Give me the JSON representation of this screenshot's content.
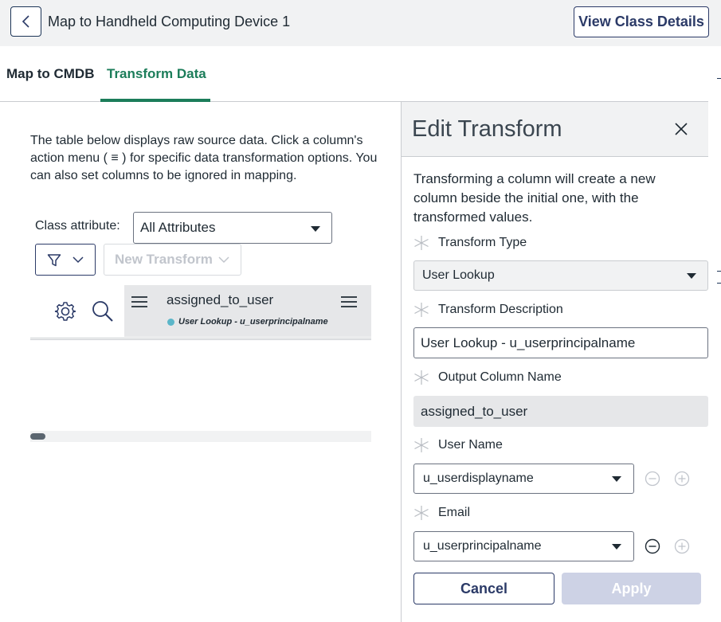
{
  "header": {
    "back_icon": "chevron-left-icon",
    "title": "Map to Handheld Computing Device 1",
    "view_class_details_label": "View Class Details"
  },
  "tabs": [
    {
      "label": "Map to CMDB",
      "active": false
    },
    {
      "label": "Transform Data",
      "active": true
    }
  ],
  "colors": {
    "accent_green": "#1c7d5a",
    "brand_navy": "#2b3a67",
    "status_dot": "#5bb6c9",
    "apply_disabled": "#cdd2e5"
  },
  "left": {
    "description": "The table below displays raw source data. Click a column's action menu ( ≡ ) for specific data transformation options. You can also set columns to be ignored in mapping.",
    "class_attribute_label": "Class attribute:",
    "class_attribute_value": "All Attributes",
    "new_transform_label": "New Transform",
    "column": {
      "name": "assigned_to_user",
      "subtitle": "User Lookup - u_userprincipalname"
    }
  },
  "panel": {
    "title": "Edit Transform",
    "description": "Transforming a column will create a new column beside the initial one, with the transformed values.",
    "transform_type_label": "Transform Type",
    "transform_type_value": "User Lookup",
    "transform_description_label": "Transform Description",
    "transform_description_value": "User Lookup - u_userprincipalname",
    "output_column_label": "Output Column Name",
    "output_column_value": "assigned_to_user",
    "user_name_label": "User Name",
    "user_name_value": "u_userdisplayname",
    "email_label": "Email",
    "email_value": "u_userprincipalname",
    "cancel_label": "Cancel",
    "apply_label": "Apply"
  }
}
